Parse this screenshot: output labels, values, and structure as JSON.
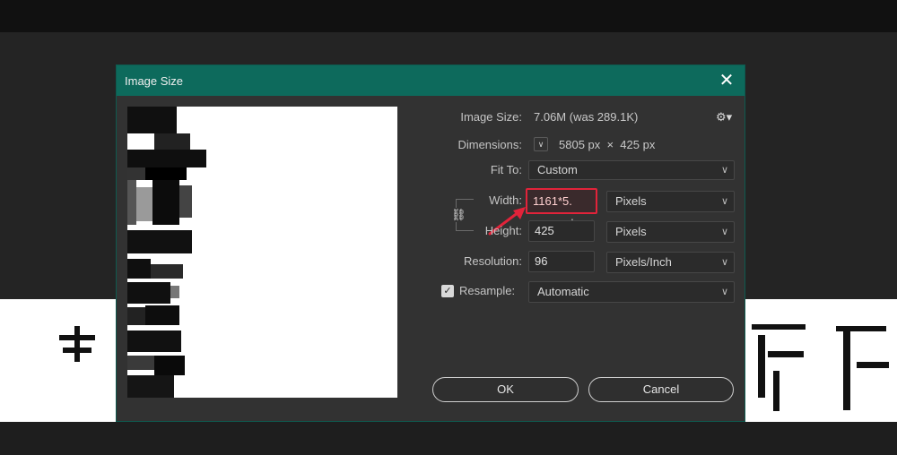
{
  "dialog": {
    "title": "Image Size",
    "close_glyph": "✕"
  },
  "fields": {
    "image_size_label": "Image Size:",
    "image_size_value": "7.06M (was 289.1K)",
    "dimensions_label": "Dimensions:",
    "dimensions_value": "5805 px  ×  425 px",
    "fit_to_label": "Fit To:",
    "fit_to_value": "Custom",
    "width_label": "Width:",
    "width_value": "1161*5.",
    "width_unit": "Pixels",
    "height_label": "Height:",
    "height_value": "425",
    "height_unit": "Pixels",
    "resolution_label": "Resolution:",
    "resolution_value": "96",
    "resolution_unit": "Pixels/Inch",
    "resample_label": "Resample:",
    "resample_checked": true,
    "resample_value": "Automatic"
  },
  "buttons": {
    "ok": "OK",
    "cancel": "Cancel"
  },
  "icons": {
    "gear": "gear-icon",
    "link": "chain-link-icon",
    "chevron": "chevron-down-icon",
    "annotation": "red-arrow-annotation"
  },
  "colors": {
    "titlebar": "#0d6a5c",
    "highlight": "#e2233a",
    "dialog_bg": "#323232"
  }
}
